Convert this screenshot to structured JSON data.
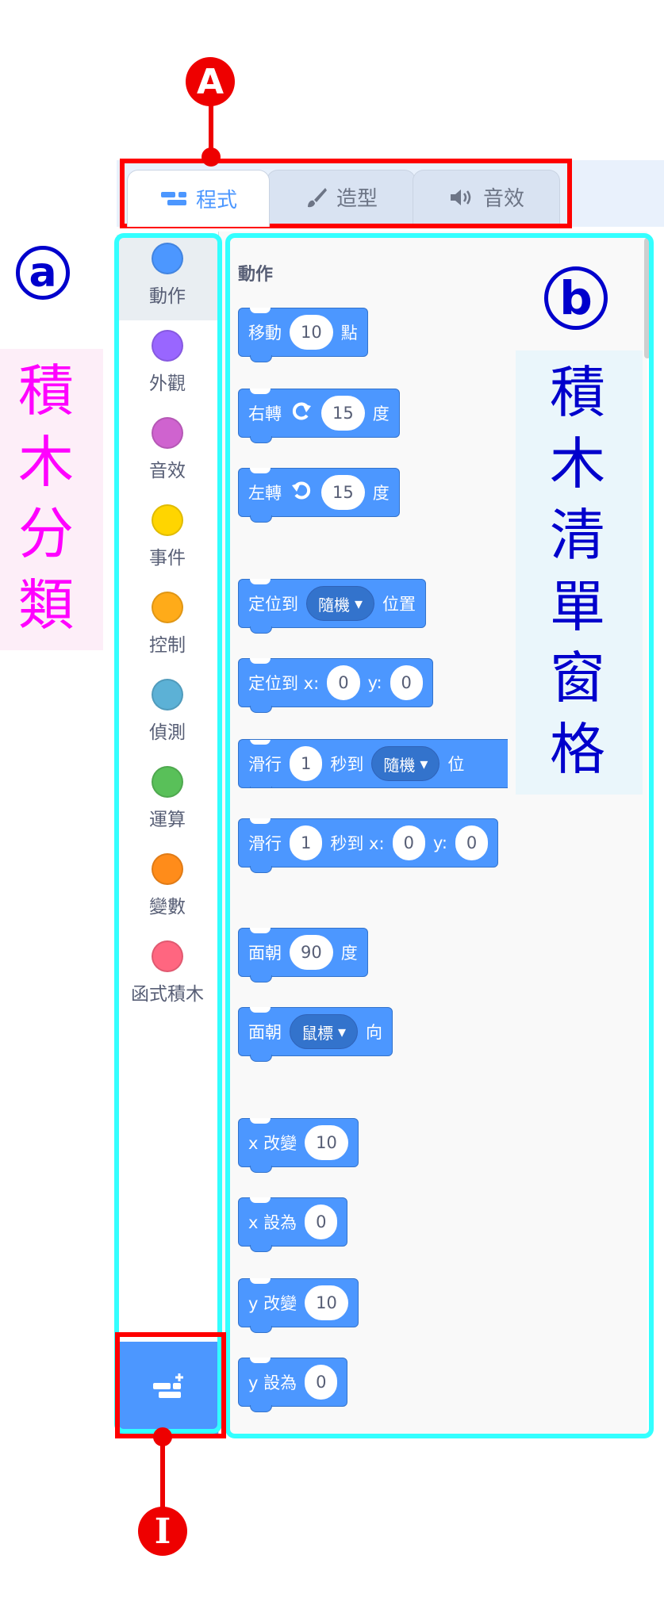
{
  "tabs": [
    {
      "label": "程式",
      "icon": "code-blocks-icon",
      "active": true
    },
    {
      "label": "造型",
      "icon": "paintbrush-icon",
      "active": false
    },
    {
      "label": "音效",
      "icon": "speaker-icon",
      "active": false
    }
  ],
  "categories": [
    {
      "label": "動作",
      "color": "#4c97ff",
      "selected": true
    },
    {
      "label": "外觀",
      "color": "#9966ff"
    },
    {
      "label": "音效",
      "color": "#cf63cf"
    },
    {
      "label": "事件",
      "color": "#ffd500"
    },
    {
      "label": "控制",
      "color": "#ffab19"
    },
    {
      "label": "偵測",
      "color": "#5cb1d6"
    },
    {
      "label": "運算",
      "color": "#59c059"
    },
    {
      "label": "變數",
      "color": "#ff8c1a"
    },
    {
      "label": "函式積木",
      "color": "#ff6680"
    }
  ],
  "palette": {
    "section_title": "動作",
    "blocks": {
      "move": {
        "t1": "移動",
        "v1": "10",
        "t2": "點"
      },
      "turn_right": {
        "t1": "右轉",
        "v1": "15",
        "t2": "度"
      },
      "turn_left": {
        "t1": "左轉",
        "v1": "15",
        "t2": "度"
      },
      "goto": {
        "t1": "定位到",
        "drop": "隨機",
        "t2": "位置"
      },
      "goto_xy": {
        "t1": "定位到 x:",
        "v1": "0",
        "t2": "y:",
        "v2": "0"
      },
      "glide": {
        "t1": "滑行",
        "v1": "1",
        "t2": "秒到",
        "drop": "隨機",
        "t3": "位"
      },
      "glide_xy": {
        "t1": "滑行",
        "v1": "1",
        "t2": "秒到 x:",
        "v2": "0",
        "t3": "y:",
        "v3": "0"
      },
      "point_dir": {
        "t1": "面朝",
        "v1": "90",
        "t2": "度"
      },
      "point_towards": {
        "t1": "面朝",
        "drop": "鼠標",
        "t2": "向"
      },
      "change_x": {
        "t1": "x 改變",
        "v1": "10"
      },
      "set_x": {
        "t1": "x 設為",
        "v1": "0"
      },
      "change_y": {
        "t1": "y 改變",
        "v1": "10"
      },
      "set_y": {
        "t1": "y 設為",
        "v1": "0"
      }
    }
  },
  "annotations": {
    "label_A": "A",
    "label_a": "a",
    "label_b": "b",
    "label_I": "I",
    "category_caption": "積木分類",
    "palette_caption": "積木清單窗格"
  },
  "colors": {
    "motion_blue": "#4c97ff",
    "annotation_red": "#ff0000",
    "annotation_cyan": "#33ffff",
    "caption_magenta": "#ff00ff",
    "caption_blue": "#0000cc"
  }
}
